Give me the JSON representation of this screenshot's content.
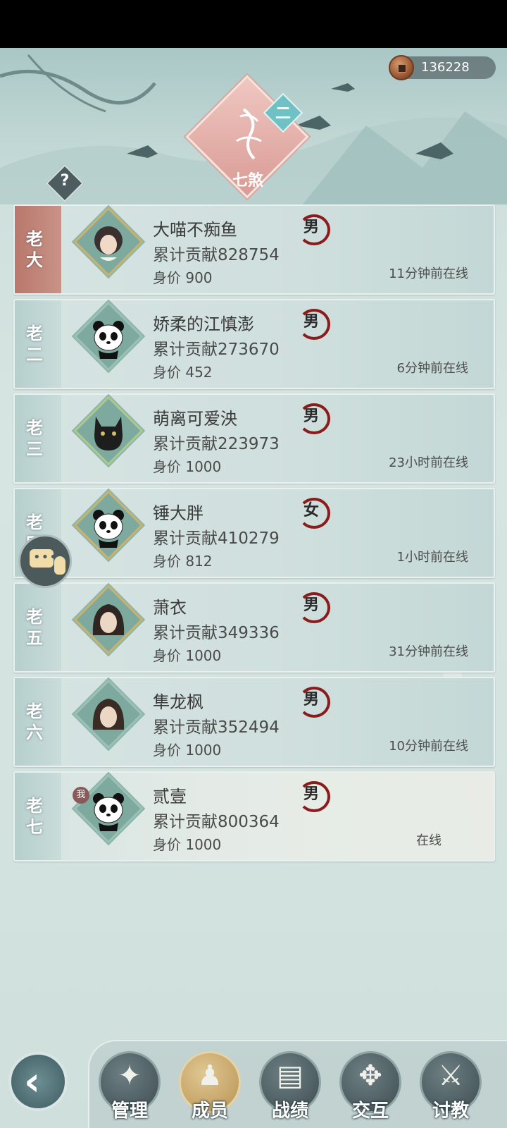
{
  "currency": {
    "icon": "copper-coin-icon",
    "amount": "136228"
  },
  "guild": {
    "emblem_text": "七煞",
    "rank_badge": "二",
    "help": "?"
  },
  "members": [
    {
      "rank": "老大",
      "name": "大喵不痴鱼",
      "contribution": "累计贡献828754",
      "value": "身价 900",
      "gender": "男",
      "status": "11分钟前在线",
      "avatar": "portrait-woman-icon"
    },
    {
      "rank": "老二",
      "name": "娇柔的江慎澎",
      "contribution": "累计贡献273670",
      "value": "身价 452",
      "gender": "男",
      "status": "6分钟前在线",
      "avatar": "panda-icon"
    },
    {
      "rank": "老三",
      "name": "萌离可爱泱",
      "contribution": "累计贡献223973",
      "value": "身价 1000",
      "gender": "男",
      "status": "23小时前在线",
      "avatar": "black-cat-icon"
    },
    {
      "rank": "老四",
      "name": "锤大胖",
      "contribution": "累计贡献410279",
      "value": "身价 812",
      "gender": "女",
      "status": "1小时前在线",
      "avatar": "panda-icon"
    },
    {
      "rank": "老五",
      "name": "萧衣",
      "contribution": "累计贡献349336",
      "value": "身价 1000",
      "gender": "男",
      "status": "31分钟前在线",
      "avatar": "portrait-man-icon"
    },
    {
      "rank": "老六",
      "name": "隼龙枫",
      "contribution": "累计贡献352494",
      "value": "身价 1000",
      "gender": "男",
      "status": "10分钟前在线",
      "avatar": "portrait-man-icon"
    },
    {
      "rank": "老七",
      "name": "贰壹",
      "contribution": "累计贡献800364",
      "value": "身价 1000",
      "gender": "男",
      "status": "在线",
      "avatar": "panda-icon",
      "me_tag": "我"
    }
  ],
  "nav": {
    "back_glyph": "‹",
    "items": [
      {
        "label": "管理",
        "icon": "manage-icon",
        "glyph": "✦"
      },
      {
        "label": "成员",
        "icon": "members-icon",
        "glyph": "♟"
      },
      {
        "label": "战绩",
        "icon": "scroll-icon",
        "glyph": "▤"
      },
      {
        "label": "交互",
        "icon": "interact-icon",
        "glyph": "✥"
      },
      {
        "label": "讨教",
        "icon": "spar-icon",
        "glyph": "⚔"
      }
    ]
  },
  "colors": {
    "accent_red": "#8b1c1c",
    "first_rank": "#b9786b",
    "nav_active": "#c9a86a"
  }
}
